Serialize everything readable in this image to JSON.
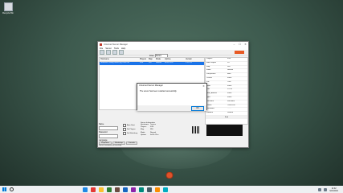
{
  "desktop": {
    "icon_label": "Recycle Bin"
  },
  "window": {
    "title": "Unturned Server Manager",
    "menu": [
      "File",
      "Server",
      "Tools",
      "Help"
    ],
    "filter": {
      "label": "Filter",
      "value": "Testsrv",
      "placeholder": "Search"
    },
    "list": {
      "columns": [
        "Hostname",
        "Players",
        "Map",
        "Mode",
        "Uptime",
        "Version"
      ],
      "rows": [
        [
          "Unturned Testing Server [E] Free Kits",
          "0/24",
          "PEI",
          "Normal",
          "0d 3h 21m",
          "3.22.5.0"
        ]
      ]
    },
    "properties": [
      [
        "Players",
        "0/24"
      ],
      [
        "Max Players",
        "24"
      ],
      [
        "Map",
        "PEI"
      ],
      [
        "Mode",
        "Normal"
      ],
      [
        "Perspective",
        "Both"
      ],
      [
        "Cheats",
        "False"
      ],
      [
        "PvP",
        "True"
      ],
      [
        "Gold",
        "False"
      ],
      [
        "Port",
        "27015"
      ],
      [
        "Hide_Admins",
        "False"
      ],
      [
        "Sync",
        "False"
      ],
      [
        "Welcome",
        "Welcome"
      ],
      [
        "Owner",
        "76561198"
      ],
      [
        "Password",
        "******"
      ],
      [
        "Loadout",
        "Default"
      ]
    ],
    "find_label": "Find",
    "left_panel": {
      "name_label": "Name",
      "password_label": "Password",
      "language_label": "Language",
      "checks": [
        "Auto Start",
        "No Plugins",
        "No Workshop"
      ]
    },
    "server_info": {
      "heading": "Server Information",
      "rows": [
        [
          "Hostname",
          "Testsrv"
        ],
        [
          "Players",
          "0/24"
        ],
        [
          "Map",
          "PEI"
        ],
        [
          "Mode",
          "Normal"
        ],
        [
          "Uptime",
          "0d 3h 21m"
        ]
      ]
    },
    "tabs": [
      "Properties",
      "Workshop",
      "Console"
    ],
    "status": "Server restarted successfully."
  },
  "dialog": {
    "title": "Unturned Server Manager",
    "message": "The server has been restarted successfully.",
    "ok": "OK"
  },
  "taskbar": {
    "time": "11:42",
    "date": "9/21/2021",
    "task_colors": [
      "#1e88e5",
      "#e53935",
      "#fbc02d",
      "#2e7d32",
      "#6d4c41",
      "#1565c0",
      "#8e24aa",
      "#00897b",
      "#455a64",
      "#fb8c00",
      "#00acc1"
    ]
  }
}
